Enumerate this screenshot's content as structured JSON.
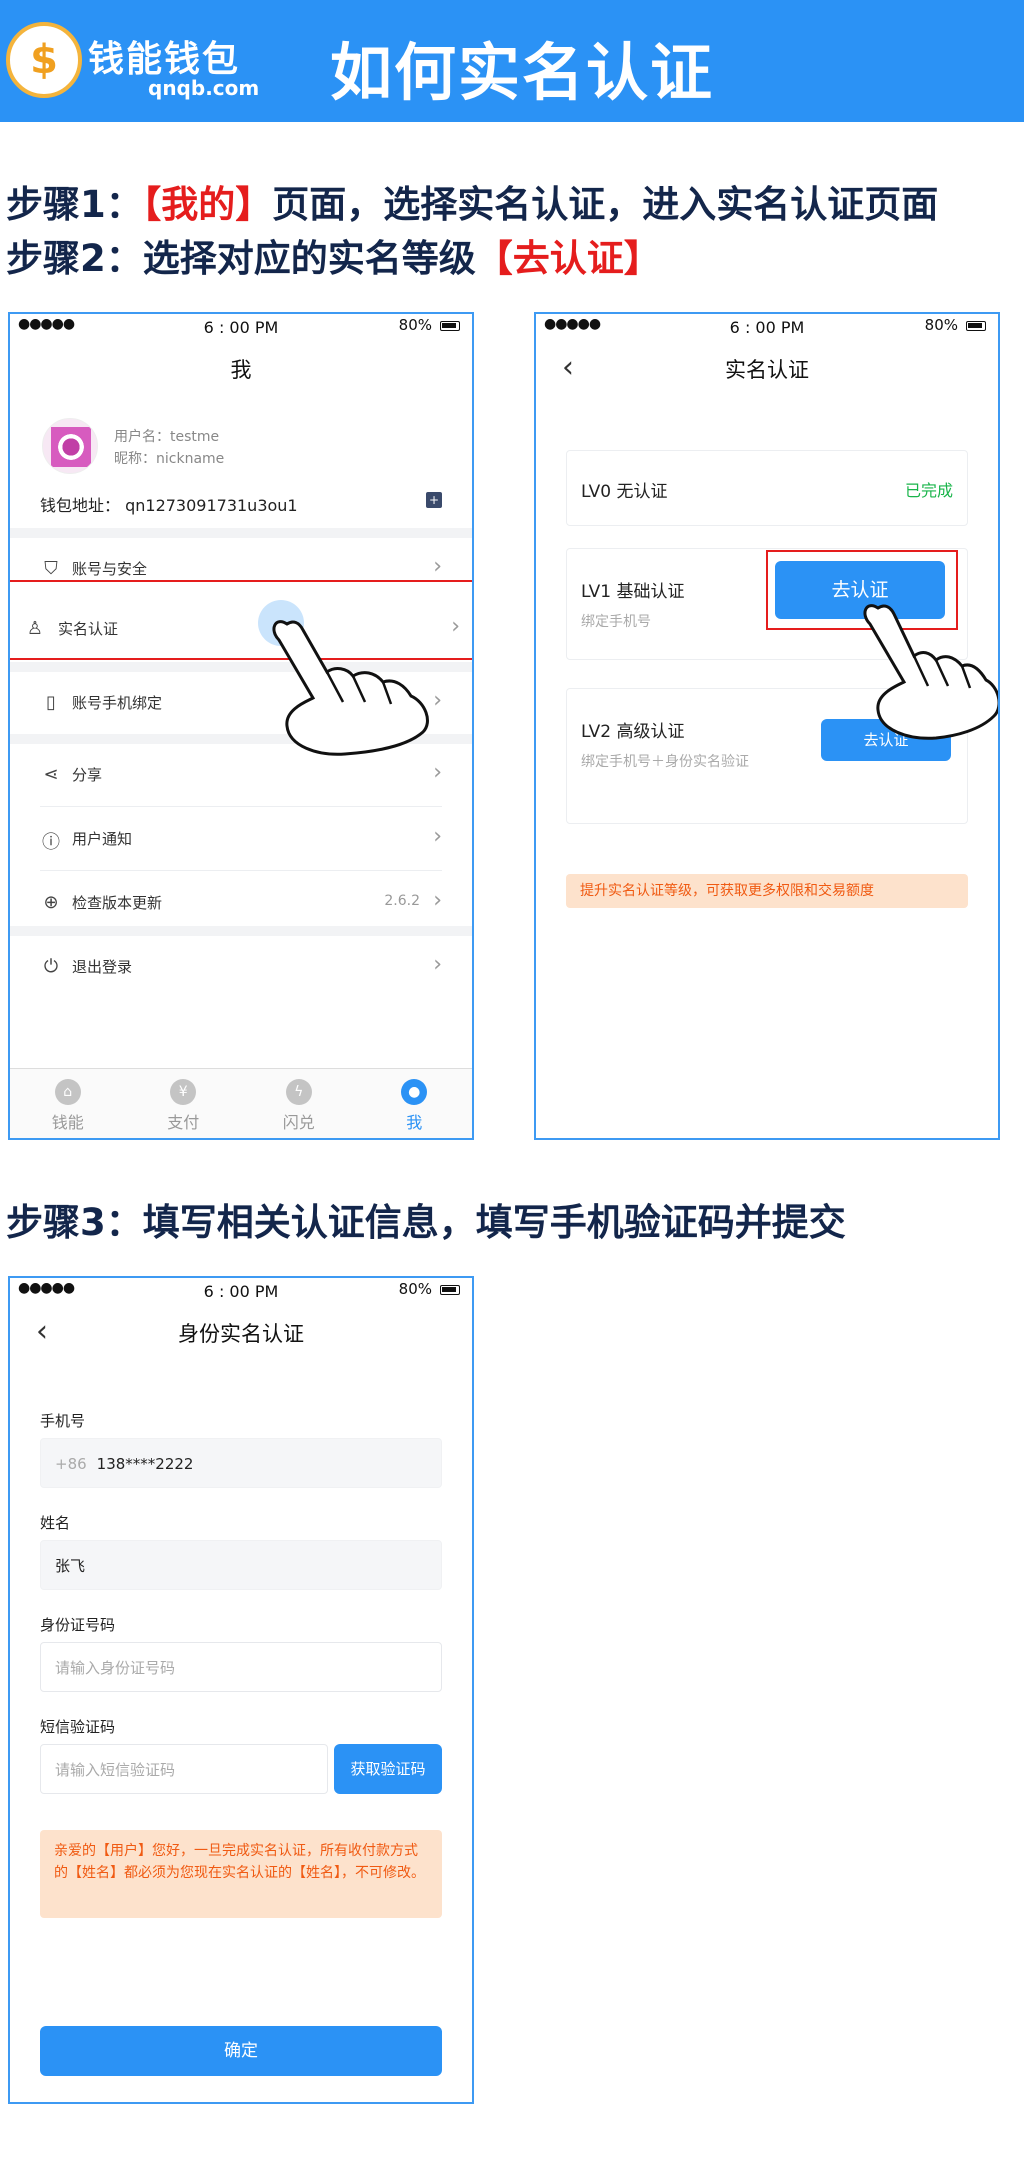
{
  "banner": {
    "logo_symbol": "$",
    "logo_text": "钱能钱包",
    "logo_sub": "qnqb.com",
    "title": "如何实名认证",
    "color": "#2b92f5"
  },
  "steps": {
    "s1_prefix": "步骤1：",
    "s1_red": "【我的】",
    "s1_suffix": "页面，选择实名认证，进入实名认证页面",
    "s2_prefix": "步骤2：选择对应的实名等级",
    "s2_red": "【去认证】",
    "s3": "步骤3：填写相关认证信息，填写手机验证码并提交"
  },
  "status_bar": {
    "signal": "●●●●● ",
    "time": "6 : 00 PM",
    "battery": "80%"
  },
  "screen_me": {
    "title": "我",
    "username": "用户名：testme",
    "nickname": "昵称：nickname",
    "wallet_address": "钱包地址：  qn1273091731u3ou1",
    "menu": [
      {
        "label": "账号与安全",
        "icon": "shield-icon"
      },
      {
        "label": "实名认证",
        "icon": "user-verify-icon"
      },
      {
        "label": "账号手机绑定",
        "icon": "phone-icon"
      },
      {
        "label": "分享",
        "icon": "share-icon"
      },
      {
        "label": "用户通知",
        "icon": "notice-icon"
      },
      {
        "label": "检查版本更新",
        "icon": "update-icon",
        "value": "2.6.2"
      },
      {
        "label": "退出登录",
        "icon": "power-icon"
      }
    ],
    "tabs": [
      {
        "label": "钱能",
        "icon": "home-icon"
      },
      {
        "label": "支付",
        "icon": "yen-icon"
      },
      {
        "label": "闪兑",
        "icon": "flash-icon"
      },
      {
        "label": "我",
        "icon": "profile-icon"
      }
    ]
  },
  "screen_verify": {
    "title": "实名认证",
    "lv0": {
      "title": "LV0 无认证",
      "status": "已完成"
    },
    "lv1": {
      "title": "LV1 基础认证",
      "sub": "绑定手机号",
      "button": "去认证"
    },
    "lv2": {
      "title": "LV2 高级认证",
      "sub": "绑定手机号＋身份实名验证",
      "button": "去认证"
    },
    "notice": "提升实名认证等级，可获取更多权限和交易额度"
  },
  "screen_identity": {
    "title": "身份实名认证",
    "phone_label": "手机号",
    "phone_prefix": "+86",
    "phone_value": "138****2222",
    "name_label": "姓名",
    "name_value": "张飞",
    "id_label": "身份证号码",
    "id_placeholder": "请输入身份证号码",
    "sms_label": "短信验证码",
    "sms_placeholder": "请输入短信验证码",
    "sms_button": "获取验证码",
    "warning": "亲爱的【用户】您好，一旦完成实名认证，所有收付款方式的【姓名】都必须为您现在实名认证的【姓名】，不可修改。",
    "confirm": "确定"
  }
}
